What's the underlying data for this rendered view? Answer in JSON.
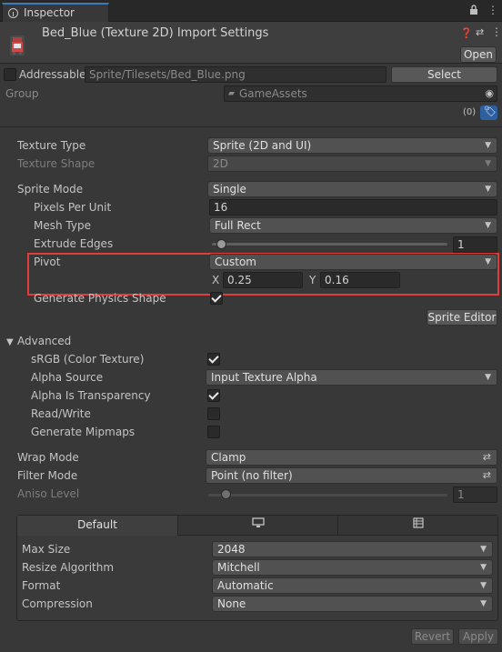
{
  "tab": {
    "label": "Inspector"
  },
  "header": {
    "title": "Bed_Blue (Texture 2D) Import Settings",
    "open_label": "Open"
  },
  "addressable": {
    "label": "Addressable",
    "path": "Sprite/Tilesets/Bed_Blue.png",
    "select_label": "Select",
    "group_label": "Group",
    "group_value": "GameAssets",
    "label_count": "(0)"
  },
  "settings": {
    "texture_type": {
      "label": "Texture Type",
      "value": "Sprite (2D and UI)"
    },
    "texture_shape": {
      "label": "Texture Shape",
      "value": "2D"
    },
    "sprite_mode": {
      "label": "Sprite Mode",
      "value": "Single"
    },
    "pixels_per_unit": {
      "label": "Pixels Per Unit",
      "value": "16"
    },
    "mesh_type": {
      "label": "Mesh Type",
      "value": "Full Rect"
    },
    "extrude_edges": {
      "label": "Extrude Edges",
      "value": "1",
      "level": 0.04
    },
    "pivot": {
      "label": "Pivot",
      "value": "Custom",
      "x_label": "X",
      "x_value": "0.25",
      "y_label": "Y",
      "y_value": "0.16"
    },
    "generate_physics": {
      "label": "Generate Physics Shape",
      "checked": true
    },
    "sprite_editor_label": "Sprite Editor"
  },
  "advanced": {
    "label": "Advanced",
    "srgb": {
      "label": "sRGB (Color Texture)",
      "checked": true
    },
    "alpha_source": {
      "label": "Alpha Source",
      "value": "Input Texture Alpha"
    },
    "alpha_transparency": {
      "label": "Alpha Is Transparency",
      "checked": true
    },
    "read_write": {
      "label": "Read/Write",
      "checked": false
    },
    "mipmaps": {
      "label": "Generate Mipmaps",
      "checked": false
    }
  },
  "wrap": {
    "wrap_mode": {
      "label": "Wrap Mode",
      "value": "Clamp"
    },
    "filter_mode": {
      "label": "Filter Mode",
      "value": "Point (no filter)"
    },
    "aniso_level": {
      "label": "Aniso Level",
      "value": "1",
      "level": 0.08
    }
  },
  "platform": {
    "tabs": [
      "Default",
      "monitor-icon",
      "grid-icon"
    ],
    "max_size": {
      "label": "Max Size",
      "value": "2048"
    },
    "resize_algorithm": {
      "label": "Resize Algorithm",
      "value": "Mitchell"
    },
    "format": {
      "label": "Format",
      "value": "Automatic"
    },
    "compression": {
      "label": "Compression",
      "value": "None"
    }
  },
  "footer": {
    "revert_label": "Revert",
    "apply_label": "Apply"
  },
  "colors": {
    "highlight": "#e03c3c",
    "accent": "#3a79bb",
    "tag_badge": "#2e5f9e"
  }
}
